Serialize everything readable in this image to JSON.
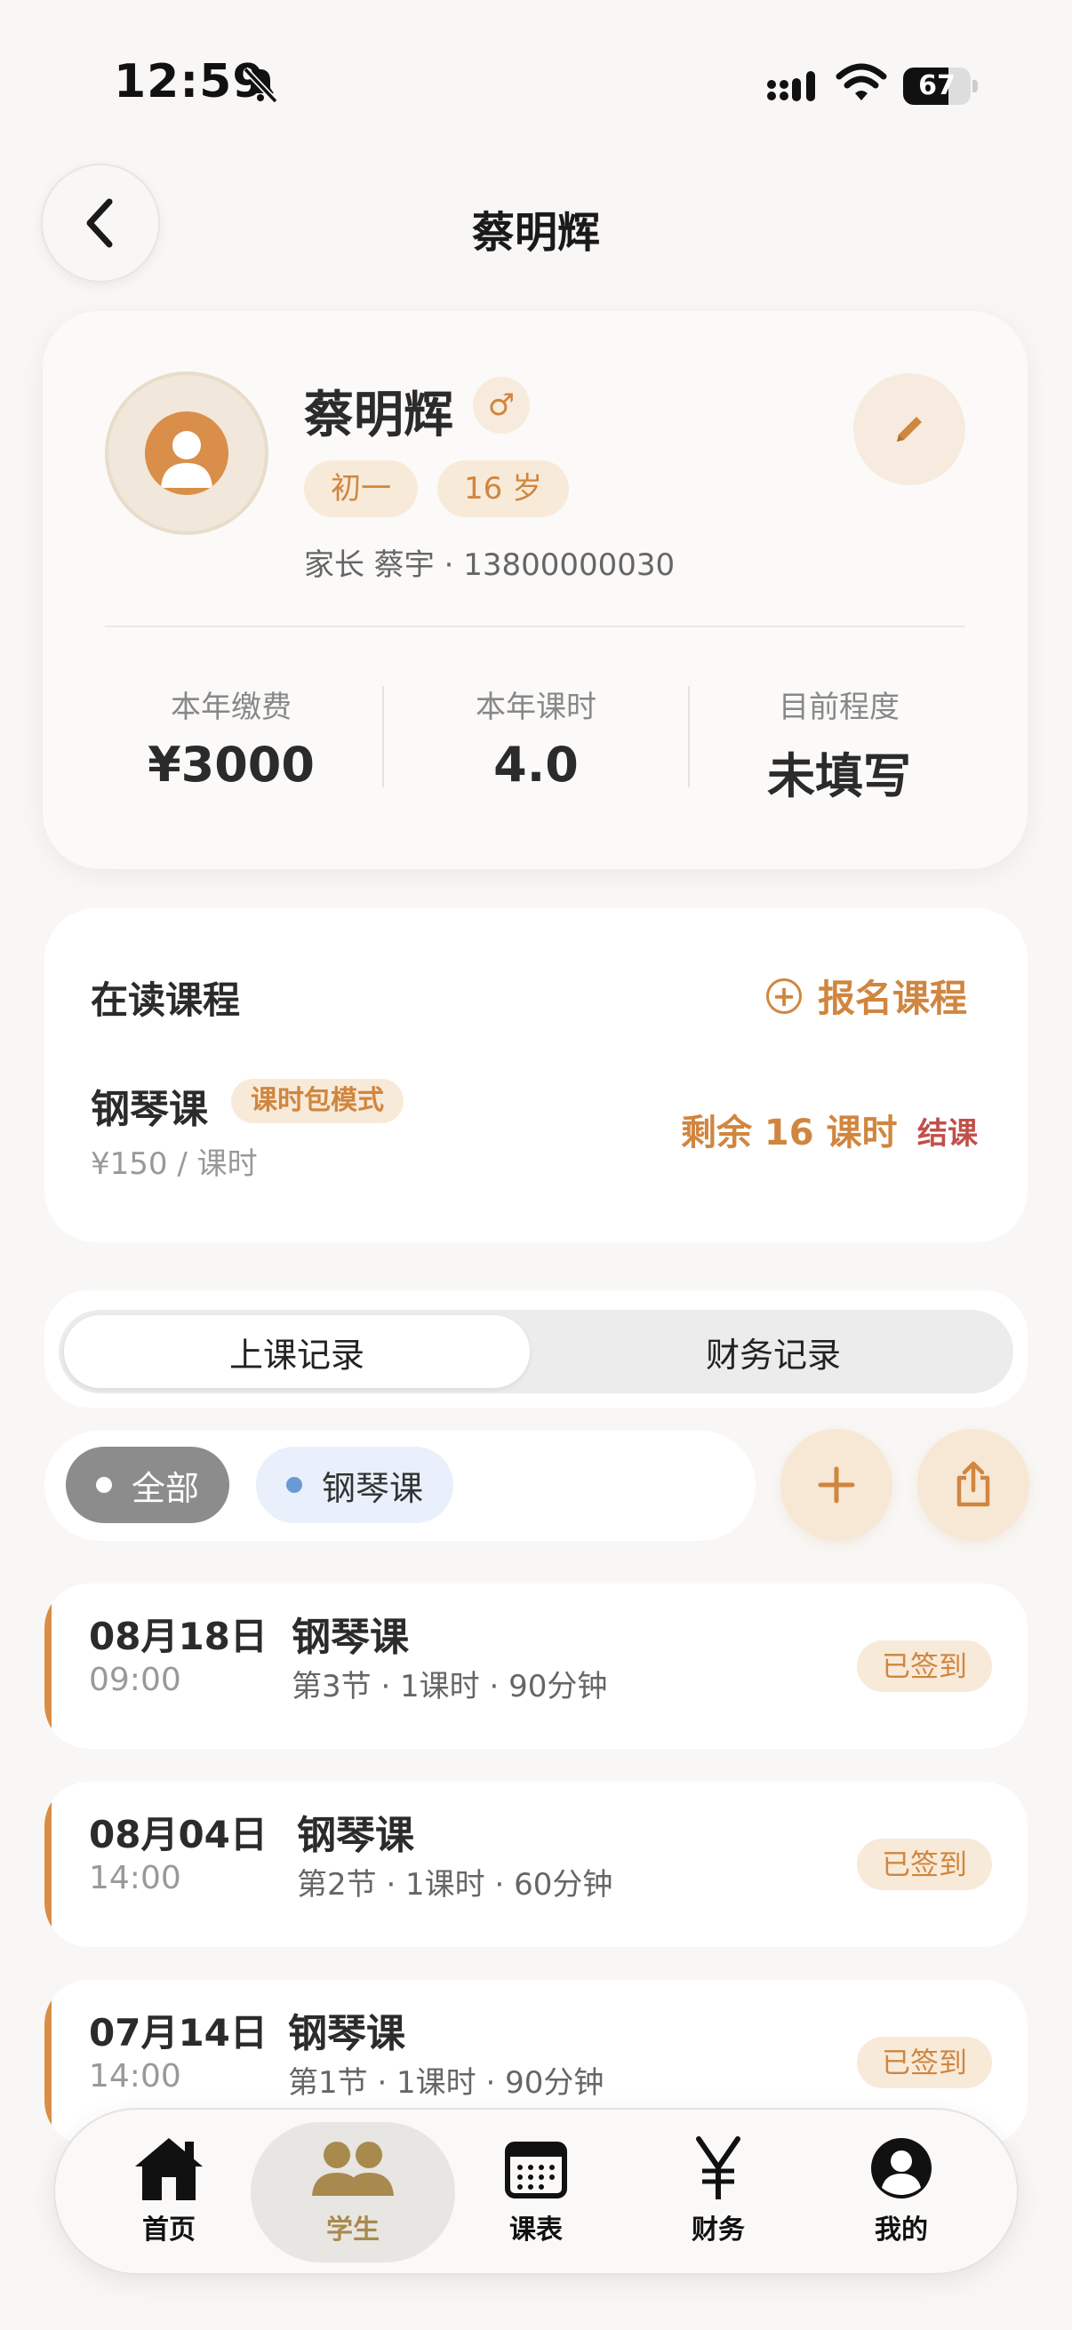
{
  "status_bar": {
    "time": "12:59",
    "battery": "67",
    "battery_level": 0.67
  },
  "header": {
    "title": "蔡明辉"
  },
  "profile": {
    "name": "蔡明辉",
    "gender_symbol": "♂",
    "grade": "初一",
    "age": "16 岁",
    "parent": "家长 蔡宇 · 13800000030",
    "stats": [
      {
        "label": "本年缴费",
        "value": "¥3000"
      },
      {
        "label": "本年课时",
        "value": "4.0"
      },
      {
        "label": "目前程度",
        "value": "未填写"
      }
    ]
  },
  "courses": {
    "title": "在读课程",
    "enroll_label": "报名课程",
    "items": [
      {
        "name": "钢琴课",
        "mode": "课时包模式",
        "price": "¥150 / 课时",
        "remaining": "剩余 16 课时",
        "end_label": "结课"
      }
    ]
  },
  "tabs": {
    "attendance": "上课记录",
    "finance": "财务记录"
  },
  "filters": {
    "all": "全部",
    "piano": "钢琴课"
  },
  "records": [
    {
      "date": "08月18日",
      "time": "09:00",
      "course": "钢琴课",
      "detail": "第3节 · 1课时 · 90分钟",
      "status": "已签到"
    },
    {
      "date": "08月04日",
      "time": "14:00",
      "course": "钢琴课",
      "detail": "第2节 · 1课时 · 60分钟",
      "status": "已签到"
    },
    {
      "date": "07月14日",
      "time": "14:00",
      "course": "钢琴课",
      "detail": "第1节 · 1课时 · 90分钟",
      "status": "已签到"
    }
  ],
  "nav": [
    {
      "label": "首页",
      "icon": "home-icon"
    },
    {
      "label": "学生",
      "icon": "students-icon"
    },
    {
      "label": "课表",
      "icon": "calendar-icon"
    },
    {
      "label": "财务",
      "icon": "yen-icon"
    },
    {
      "label": "我的",
      "icon": "profile-icon"
    }
  ],
  "colors": {
    "accent": "#d0863f",
    "danger": "#c0504a",
    "nav_active": "#a88a4e"
  }
}
